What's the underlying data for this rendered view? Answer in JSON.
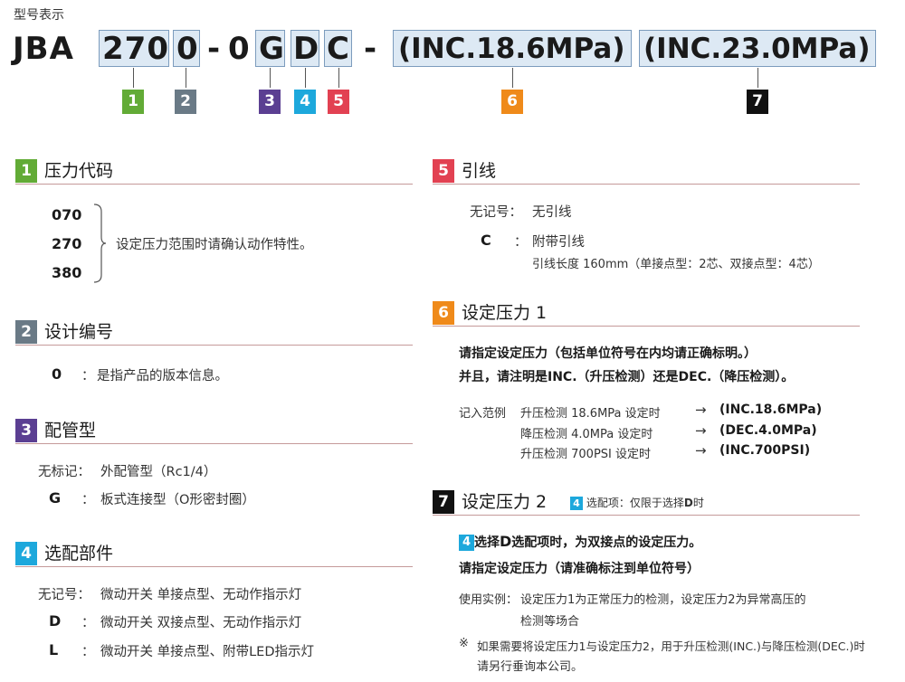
{
  "caption": "型号表示",
  "model": {
    "prefix": "JBA",
    "pressure_code": "270",
    "design_no": "0",
    "dash1": "-",
    "zero": "0",
    "piping": "G",
    "option": "D",
    "lead": "C",
    "dash2": "-",
    "setting1": "(INC.18.6MPa)",
    "setting2": "(INC.23.0MPa)",
    "badges": [
      "1",
      "2",
      "3",
      "4",
      "5",
      "6",
      "7"
    ]
  },
  "colors": {
    "s1": "#62ab36",
    "s2": "#6a7a86",
    "s3": "#5b3f92",
    "s4": "#1da8dc",
    "s5": "#e24152",
    "s6": "#ef8a1a",
    "s7": "#111111",
    "highlight": "#dde9f4"
  },
  "sec1": {
    "num": "1",
    "title": "压力代码",
    "codes": [
      "070",
      "270",
      "380"
    ],
    "note": "设定压力范围时请确认动作特性。"
  },
  "sec2": {
    "num": "2",
    "title": "设计编号",
    "code": "0",
    "colon": "：",
    "desc": "是指产品的版本信息。"
  },
  "sec3": {
    "num": "3",
    "title": "配管型",
    "rows": [
      {
        "key": "无标记：",
        "desc": "外配管型（Rc1/4）"
      },
      {
        "key": "G",
        "colon": "：",
        "desc": "板式连接型（O形密封圈）"
      }
    ]
  },
  "sec4": {
    "num": "4",
    "title": "选配部件",
    "rows": [
      {
        "key": "无记号：",
        "desc": "微动开关  单接点型、无动作指示灯"
      },
      {
        "key": "D",
        "colon": "：",
        "desc": "微动开关  双接点型、无动作指示灯"
      },
      {
        "key": "L",
        "colon": "：",
        "desc": "微动开关  单接点型、附带LED指示灯"
      }
    ]
  },
  "sec5": {
    "num": "5",
    "title": "引线",
    "row1_key": "无记号：",
    "row1_desc": "无引线",
    "row2_key": "C",
    "row2_colon": "：",
    "row2_desc": "附带引线",
    "row2_note": "引线长度 160mm（单接点型：2芯、双接点型：4芯）"
  },
  "sec6": {
    "num": "6",
    "title": "设定压力 1",
    "line1": "请指定设定压力（包括单位符号在内均请正确标明。）",
    "line2": "并且，请注明是INC.（升压检测）还是DEC.（降压检测）。",
    "example_label": "记入范例",
    "examples": [
      {
        "desc": "升压检测 18.6MPa 设定时",
        "arrow": "→",
        "code": "(INC.18.6MPa)"
      },
      {
        "desc": "降压检测  4.0MPa 设定时",
        "arrow": "→",
        "code": "(DEC.4.0MPa)"
      },
      {
        "desc": "升压检测  700PSI 设定时",
        "arrow": "→",
        "code": "(INC.700PSI)"
      }
    ]
  },
  "sec7": {
    "num": "7",
    "title": "设定压力 2",
    "option_badge": "4",
    "option_note": "选配项：仅限于选择",
    "option_note_d": "D",
    "option_note_end": "时",
    "line1_badge": "4",
    "line1_a": "选择",
    "line1_d": "D",
    "line1_b": "选配项时，为双接点的设定压力。",
    "line2": "请指定设定压力（请准确标注到单位符号）",
    "usage_label": "使用实例：",
    "usage_1": "设定压力1为正常压力的检测，设定压力2为异常高压的",
    "usage_2": "检测等场合",
    "note_mark": "※",
    "note_1": "如果需要将设定压力1与设定压力2，用于升压检测(INC.)与降压检测(DEC.)时",
    "note_2": "请另行垂询本公司。"
  }
}
